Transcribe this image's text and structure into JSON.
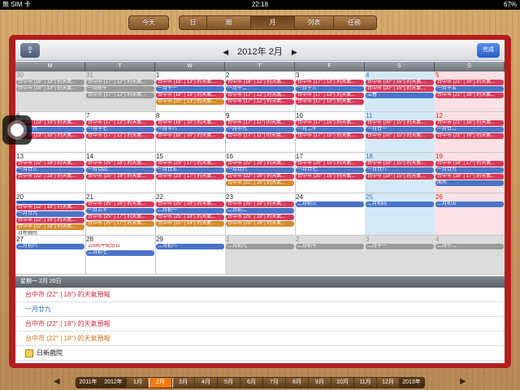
{
  "status": {
    "carrier": "無 SIM 卡",
    "time": "22:18",
    "battery": "67%"
  },
  "segments": {
    "today": "今天",
    "views": [
      "日",
      "周",
      "月",
      "列表",
      "任務"
    ],
    "active_view_index": 2
  },
  "calendar": {
    "title": "2012年  2月",
    "prev_arrow": "◀",
    "next_arrow": "▶",
    "done_label": "完成",
    "weekdays": [
      "M",
      "T",
      "W",
      "T",
      "F",
      "S",
      "S"
    ],
    "weeks": [
      [
        {
          "n": "30",
          "k": "grey",
          "ev": [
            [
              "grey",
              "台中市 (18° | 13°) 的天氣..."
            ],
            [
              "grey",
              "台中市 (18° | 13°) 的天氣..."
            ]
          ]
        },
        {
          "n": "31",
          "k": "grey",
          "ev": [
            [
              "grey",
              "台中市 (17° | 12°) 的天氣..."
            ],
            [
              "grey",
              "一月初十"
            ],
            [
              "grey",
              "台中市 (17° | 12°) 的天氣..."
            ]
          ]
        },
        {
          "n": "1",
          "k": "",
          "ev": [
            [
              "red",
              "台中市 (18° | 13°) 的天氣..."
            ],
            [
              "blue",
              "一月十一"
            ],
            [
              "red",
              "台中市 (18° | 13°) 的天氣..."
            ],
            [
              "orange",
              "台中市 (20° | 13°) 的天氣..."
            ]
          ]
        },
        {
          "n": "2",
          "k": "",
          "ev": [
            [
              "red",
              "台中市 (18° | 12°) 的天氣..."
            ],
            [
              "blue",
              "一月十二"
            ],
            [
              "red",
              "台中市 (17° | 12°) 的天氣..."
            ],
            [
              "red",
              "台中市 (17° | 12°) 的天氣..."
            ]
          ]
        },
        {
          "n": "3",
          "k": "",
          "ev": [
            [
              "red",
              "台中市 (17° | 13°) 的天氣..."
            ],
            [
              "blue",
              "一月十三"
            ],
            [
              "red",
              "台中市 (17° | 13°) 的天氣..."
            ],
            [
              "red",
              "台中市 (17° | 13°) 的天氣..."
            ]
          ]
        },
        {
          "n": "4",
          "k": "sat",
          "ev": [
            [
              "red",
              "台中市 (20° | 15°) 的天氣..."
            ],
            [
              "red",
              "台中市 (20° | 15°) 的天氣..."
            ],
            [
              "blue",
              "立春"
            ]
          ]
        },
        {
          "n": "5",
          "k": "sun",
          "ev": [
            [
              "red",
              "台中市 (21° | 16°) 的天氣..."
            ],
            [
              "blue",
              "一月十五"
            ],
            [
              "red",
              "台中市 (21° | 16°) 的天氣..."
            ]
          ]
        }
      ],
      [
        {
          "n": "6",
          "k": "",
          "ev": [
            [
              "red",
              "台中市 (23° | 16°) 的天氣..."
            ],
            [
              "blue",
              "一月十六"
            ],
            [
              "red",
              "台中市 (23° | 16°) 的天氣..."
            ]
          ]
        },
        {
          "n": "7",
          "k": "",
          "ev": [
            [
              "red",
              "台中市 (17° | 12°) 的天氣..."
            ],
            [
              "blue",
              "一月十七"
            ],
            [
              "red",
              "台中市 (17° | 12°) 的天氣..."
            ]
          ]
        },
        {
          "n": "8",
          "k": "",
          "ev": [
            [
              "red",
              "台中市 (16° | 10°) 的天氣..."
            ],
            [
              "blue",
              "一月十八"
            ],
            [
              "red",
              "台中市 (16° | 10°) 的天氣..."
            ]
          ]
        },
        {
          "n": "9",
          "k": "",
          "ev": [
            [
              "red",
              "台中市 (17° | 11°) 的天氣..."
            ],
            [
              "blue",
              "一月十九"
            ],
            [
              "red",
              "台中市 (17° | 11°) 的天氣..."
            ]
          ]
        },
        {
          "n": "10",
          "k": "",
          "ev": [
            [
              "red",
              "台中市 (17° | 15°) 的天氣..."
            ],
            [
              "blue",
              "一月二十"
            ],
            [
              "red",
              "台中市 (17° | 15°) 的天氣..."
            ]
          ]
        },
        {
          "n": "11",
          "k": "sat",
          "ev": [
            [
              "red",
              "台中市 (20° | 15°) 的天氣..."
            ],
            [
              "blue",
              "一月廿一"
            ],
            [
              "red",
              "台中市 (20° | 15°) 的天氣..."
            ]
          ]
        },
        {
          "n": "12",
          "k": "sun",
          "ev": [
            [
              "red",
              "台中市 (21° | 16°) 的天氣..."
            ],
            [
              "blue",
              "一月廿二"
            ],
            [
              "red",
              "台中市 (21° | 16°) 的天氣..."
            ]
          ]
        }
      ],
      [
        {
          "n": "13",
          "k": "",
          "ev": [
            [
              "red",
              "台中市 (22° | 18°) 的天氣..."
            ],
            [
              "blue",
              "一月廿三"
            ],
            [
              "red",
              "台中市 (22° | 18°) 的天氣..."
            ]
          ]
        },
        {
          "n": "14",
          "k": "",
          "ev": [
            [
              "red",
              "台中市 (25° | 18°) 的天氣..."
            ],
            [
              "blue",
              "一月廿四"
            ],
            [
              "red",
              "台中市 (25° | 18°) 的天氣..."
            ]
          ]
        },
        {
          "n": "15",
          "k": "",
          "ev": [
            [
              "red",
              "台中市 (23° | 17°) 的天氣..."
            ],
            [
              "blue",
              "一月廿五"
            ],
            [
              "red",
              "台中市 (23° | 17°) 的天氣..."
            ]
          ]
        },
        {
          "n": "16",
          "k": "",
          "ev": [
            [
              "red",
              "台中市 (22° | 16°) 的天氣..."
            ],
            [
              "blue",
              "一月廿六"
            ],
            [
              "red",
              "台中市 (22° | 16°) 的天氣..."
            ],
            [
              "orange",
              "台中市 (22° | 16°) 的天氣..."
            ]
          ]
        },
        {
          "n": "17",
          "k": "",
          "ev": [
            [
              "red",
              "台中市 (20° | 15°) 的天氣..."
            ],
            [
              "blue",
              "一月廿七"
            ],
            [
              "red",
              "台中市 (20° | 15°) 的天氣..."
            ]
          ]
        },
        {
          "n": "18",
          "k": "sat",
          "ev": [
            [
              "red",
              "台中市 (18° | 15°) 的天氣..."
            ],
            [
              "blue",
              "一月廿八"
            ],
            [
              "red",
              "台中市 (18° | 15°) 的天氣..."
            ]
          ]
        },
        {
          "n": "19",
          "k": "sun",
          "ev": [
            [
              "red",
              "台中市 (18° | 17°) 的天氣..."
            ],
            [
              "blue",
              "一月廿九"
            ],
            [
              "red",
              "台中市 (18° | 17°) 的天氣..."
            ],
            [
              "blue",
              "雨水"
            ]
          ]
        }
      ],
      [
        {
          "n": "20",
          "k": "",
          "ev": [
            [
              "todaybar",
              ""
            ],
            [
              "red",
              "台中市 (22° | 18°) 的天氣..."
            ],
            [
              "blue",
              "一月廿九"
            ],
            [
              "red",
              "台中市 (22° | 18°) 的天氣..."
            ],
            [
              "orange",
              "台中市 (22° | 18°) 的天氣..."
            ],
            [
              "txtb",
              "日新戲院"
            ]
          ]
        },
        {
          "n": "21",
          "k": "",
          "ev": [
            [
              "red",
              "台中市 (25° | 18°) 的天氣..."
            ],
            [
              "blue",
              "一月三十"
            ],
            [
              "red",
              "台中市 (25° | 17°) 的天氣..."
            ],
            [
              "orange",
              "台中市 (25° | 17°) 的天氣..."
            ]
          ]
        },
        {
          "n": "22",
          "k": "",
          "ev": [
            [
              "red",
              "台中市 (25° | 18°) 的天氣..."
            ],
            [
              "blue",
              "二月初一"
            ],
            [
              "red",
              "台中市 (25° | 18°) 的天氣..."
            ],
            [
              "orange",
              "台中市 (25° | 18°) 的天氣..."
            ]
          ]
        },
        {
          "n": "23",
          "k": "",
          "ev": [
            [
              "red",
              "台中市 (25° | 18°) 的天氣..."
            ],
            [
              "blue",
              "二月初二"
            ],
            [
              "red",
              "台中市 (25° | 18°) 的天氣..."
            ],
            [
              "orange",
              "台中市 (25° | 18°) 的天氣..."
            ]
          ]
        },
        {
          "n": "24",
          "k": "",
          "ev": [
            [
              "blue",
              "二月初三"
            ]
          ]
        },
        {
          "n": "25",
          "k": "sat",
          "ev": [
            [
              "blue",
              "二月初四"
            ]
          ]
        },
        {
          "n": "26",
          "k": "sun",
          "ev": [
            [
              "blue",
              "二月初五"
            ]
          ]
        }
      ],
      [
        {
          "n": "27",
          "k": "",
          "ev": [
            [
              "blue",
              "二月初六"
            ]
          ]
        },
        {
          "n": "28",
          "k": "",
          "ev": [
            [
              "txt",
              "228和平紀念日"
            ],
            [
              "blue",
              "二月初七"
            ]
          ]
        },
        {
          "n": "29",
          "k": "",
          "ev": [
            [
              "blue",
              "二月初八"
            ]
          ]
        },
        {
          "n": "1",
          "k": "grey",
          "ev": [
            [
              "grey",
              "二月初九"
            ]
          ]
        },
        {
          "n": "2",
          "k": "grey",
          "ev": [
            [
              "grey",
              "二月初十"
            ]
          ]
        },
        {
          "n": "3",
          "k": "grey",
          "ev": [
            [
              "grey",
              "二月十一"
            ]
          ]
        },
        {
          "n": "4",
          "k": "grey",
          "ev": [
            [
              "grey",
              "二月十二"
            ]
          ]
        }
      ]
    ]
  },
  "day_detail": {
    "header": "星期一 2月 20日",
    "items": [
      {
        "color": "red",
        "text": "台中市 (22° | 18°) 的天氣預報"
      },
      {
        "color": "blue",
        "text": "一月廿九"
      },
      {
        "color": "red",
        "text": "台中市 (22° | 18°) 的天氣預報"
      },
      {
        "color": "orange",
        "text": "台中市 (22° | 18°) 的天氣預報"
      },
      {
        "color": "dark",
        "text": "日新戲院",
        "icon": "note-icon"
      }
    ]
  },
  "bottom_nav": {
    "prev": "◀",
    "next": "▶",
    "items": [
      "2011年",
      "2012年",
      "1月",
      "2月",
      "3月",
      "4月",
      "5月",
      "6月",
      "7月",
      "8月",
      "9月",
      "10月",
      "11月",
      "12月",
      "2013年"
    ],
    "active_index": 3
  }
}
